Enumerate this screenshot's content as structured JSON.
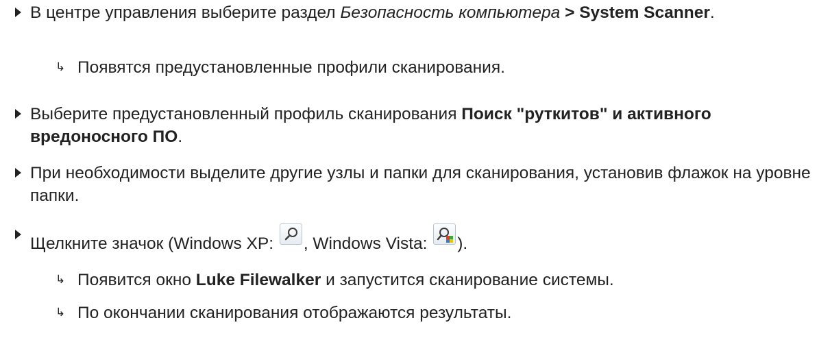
{
  "steps": [
    {
      "part1": "В центре управления выберите раздел ",
      "italic": "Безопасность компьютера",
      "part2": " > ",
      "bold": "System Scanner",
      "end": "."
    },
    {
      "part1": "Выберите предустановленный профиль сканирования ",
      "bold": "Поиск \"руткитов\" и активного вредоносного ПО",
      "end": "."
    },
    {
      "text": "При необходимости выделите другие узлы и папки для сканирования, установив флажок на уровне папки."
    },
    {
      "part1": "Щелкните значок (Windows XP: ",
      "part2": ", Windows Vista: ",
      "end": ").",
      "icon_xp": "search-xp-icon",
      "icon_vista": "search-vista-icon"
    }
  ],
  "results": [
    {
      "text": "Появятся предустановленные профили сканирования."
    },
    {
      "part1": "Появится окно ",
      "bold": "Luke Filewalker",
      "part2": " и запустится сканирование системы."
    },
    {
      "text": "По окончании сканирования отображаются результаты."
    }
  ],
  "arrow_glyph": "↳",
  "colors": {
    "text": "#222222",
    "bullet": "#222222"
  }
}
